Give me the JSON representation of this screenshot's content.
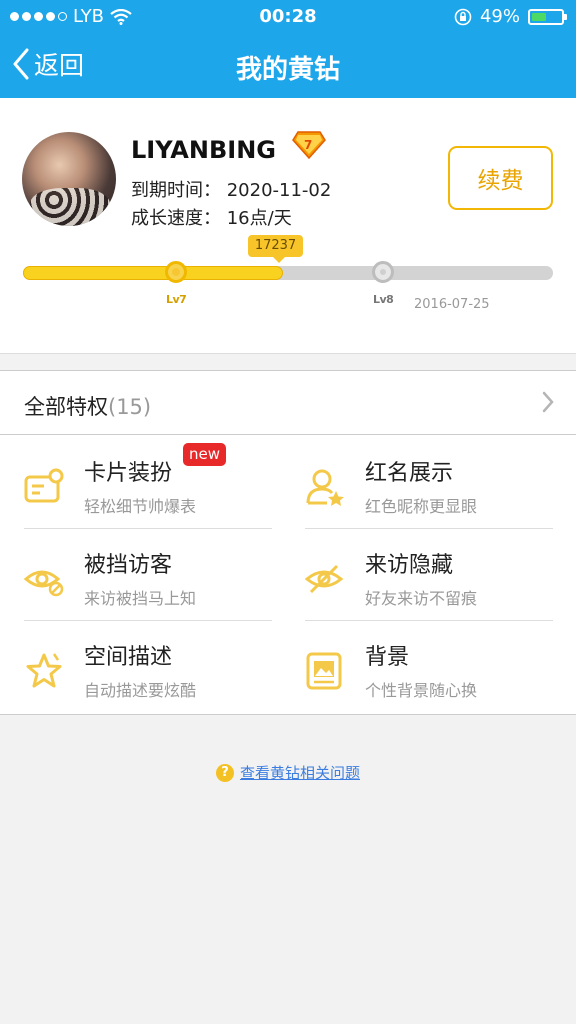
{
  "status": {
    "carrier": "LYB",
    "time": "00:28",
    "battery": "49%",
    "battery_level": 0.49
  },
  "nav": {
    "back_label": "返回",
    "title": "我的黄钻"
  },
  "profile": {
    "username": "LIYANBING",
    "expire_line": "到期时间： 2020-11-02",
    "speed_line": "成长速度： 16点/天",
    "renew_label": "续费",
    "points": "17237",
    "current_level": "Lv7",
    "next_level": "Lv8",
    "next_level_date": "2016-07-25",
    "progress": 0.49
  },
  "privileges": {
    "title": "全部特权",
    "count": "(15)",
    "items": [
      {
        "title": "卡片装扮",
        "subtitle": "轻松细节帅爆表",
        "icon": "card-icon",
        "badge": "new"
      },
      {
        "title": "红名展示",
        "subtitle": "红色昵称更显眼",
        "icon": "user-star-icon"
      },
      {
        "title": "被挡访客",
        "subtitle": "来访被挡马上知",
        "icon": "eye-block-icon"
      },
      {
        "title": "来访隐藏",
        "subtitle": "好友来访不留痕",
        "icon": "eye-hidden-icon"
      },
      {
        "title": "空间描述",
        "subtitle": "自动描述要炫酷",
        "icon": "star-icon"
      },
      {
        "title": "背景",
        "subtitle": "个性背景随心换",
        "icon": "picture-icon"
      }
    ]
  },
  "help_link": "查看黄钻相关问题",
  "colors": {
    "header": "#1ea6ea",
    "accent": "#f2b705",
    "badge": "#e8292a",
    "link": "#3b7de0"
  }
}
